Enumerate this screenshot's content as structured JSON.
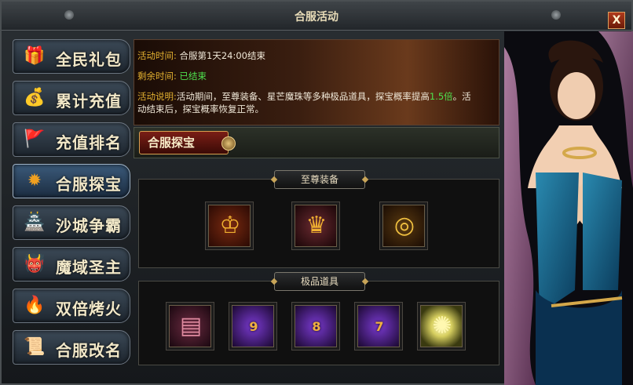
{
  "window": {
    "title": "合服活动",
    "close_label": "X"
  },
  "sidebar": {
    "items": [
      {
        "label": "全民礼包",
        "icon": "gift-icon"
      },
      {
        "label": "累计充值",
        "icon": "money-bag-icon"
      },
      {
        "label": "充值排名",
        "icon": "banner-icon"
      },
      {
        "label": "合服探宝",
        "icon": "treasure-orb-icon"
      },
      {
        "label": "沙城争霸",
        "icon": "castle-icon"
      },
      {
        "label": "魔域圣主",
        "icon": "demon-head-icon"
      },
      {
        "label": "双倍烤火",
        "icon": "bonfire-icon"
      },
      {
        "label": "合服改名",
        "icon": "scroll-quill-icon"
      }
    ],
    "active_index": 3
  },
  "info": {
    "time_key": "活动时间:",
    "time_val": "合服第1天24:00结束",
    "remain_key": "剩余时间:",
    "remain_val": "已结束",
    "desc_key": "活动说明:",
    "desc_pre": "活动期间，至尊装备、星芒魔珠等多种极品道具，探宝概率提高",
    "desc_highlight": "1.5倍",
    "desc_post": "。活",
    "desc_line2": "动结束后，探宝概率恢复正常。"
  },
  "section_tag": "合服探宝",
  "supreme": {
    "title": "至尊装备",
    "items": [
      {
        "icon": "golden-helmet-icon"
      },
      {
        "icon": "golden-armor-icon"
      },
      {
        "icon": "golden-ring-icon"
      }
    ]
  },
  "premium": {
    "title": "极品道具",
    "items": [
      {
        "icon": "scroll-icon",
        "num": ""
      },
      {
        "icon": "purple-gem-icon",
        "num": "9"
      },
      {
        "icon": "purple-gem-icon",
        "num": "8"
      },
      {
        "icon": "purple-gem-icon",
        "num": "7"
      },
      {
        "icon": "glowing-orb-icon",
        "num": ""
      }
    ]
  },
  "colors": {
    "accent_gold": "#e2b030",
    "highlight_green": "#4ee04e",
    "tab_active": "#3b5a7a",
    "gem_purple": "#7a3ad0"
  }
}
